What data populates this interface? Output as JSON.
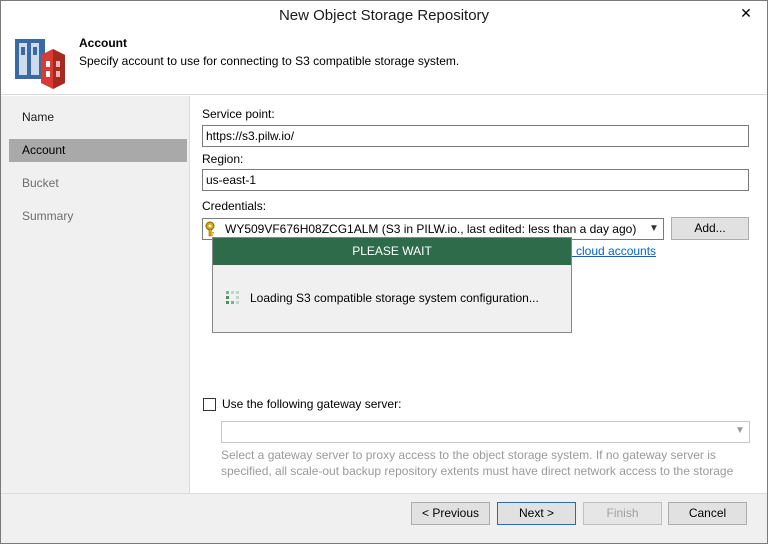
{
  "window": {
    "title": "New Object Storage Repository",
    "close_glyph": "✕"
  },
  "header": {
    "title": "Account",
    "description": "Specify account to use for connecting to S3 compatible storage system."
  },
  "nav": {
    "items": [
      {
        "label": "Name",
        "state": "normal"
      },
      {
        "label": "Account",
        "state": "active"
      },
      {
        "label": "Bucket",
        "state": "inactive"
      },
      {
        "label": "Summary",
        "state": "inactive"
      }
    ]
  },
  "form": {
    "service_point": {
      "label": "Service point:",
      "value": "https://s3.pilw.io/"
    },
    "region": {
      "label": "Region:",
      "value": "us-east-1"
    },
    "credentials": {
      "label": "Credentials:",
      "value": "WY509VF676H08ZCG1ALM (S3 in PILW.io., last edited: less than a day ago)",
      "add_button": "Add...",
      "manage_link": "e cloud accounts"
    },
    "gateway": {
      "checkbox_label": "Use the following gateway server:",
      "checked": false,
      "value": "",
      "description": "Select a gateway server to proxy access to the object storage system. If no gateway server is specified, all scale-out backup repository extents must have direct network access to the storage"
    }
  },
  "wait_dialog": {
    "title": "PLEASE WAIT",
    "message": "Loading S3 compatible storage system configuration..."
  },
  "footer": {
    "previous": "< Previous",
    "next": "Next >",
    "finish": "Finish",
    "cancel": "Cancel"
  },
  "colors": {
    "accent_green": "#2e6b4b",
    "nav_active": "#a9a9a9",
    "link": "#0066cc",
    "logo_red": "#d83b33",
    "logo_blue": "#3a6aa6"
  }
}
